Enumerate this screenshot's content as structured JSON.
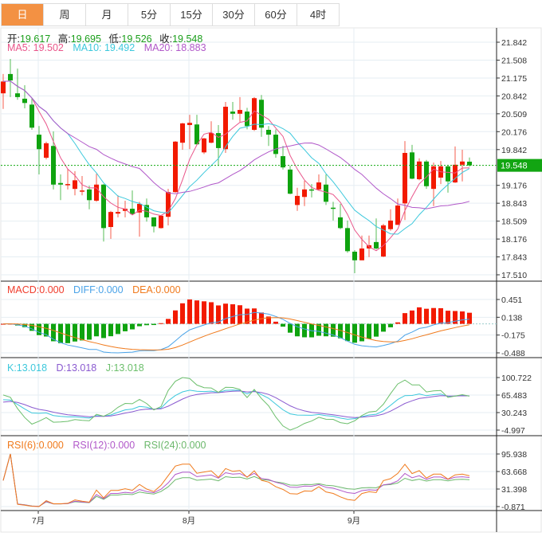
{
  "tabs": [
    {
      "label": "日",
      "active": true
    },
    {
      "label": "周"
    },
    {
      "label": "月"
    },
    {
      "label": "5分"
    },
    {
      "label": "15分"
    },
    {
      "label": "30分"
    },
    {
      "label": "60分"
    },
    {
      "label": "4时"
    }
  ],
  "ohlc_legend": {
    "open_label": "开:",
    "open": "19.617",
    "high_label": "高:",
    "high": "19.695",
    "low_label": "低:",
    "low": "19.526",
    "close_label": "收:",
    "close": "19.548"
  },
  "ma_legend": {
    "ma5": "MA5: 19.502",
    "ma10": "MA10: 19.492",
    "ma20": "MA20: 18.883"
  },
  "macd_legend": {
    "macd": "MACD:0.000",
    "diff": "DIFF:0.000",
    "dea": "DEA:0.000"
  },
  "kdj_legend": {
    "k": "K:13.018",
    "d": "D:13.018",
    "j": "J:13.018"
  },
  "rsi_legend": {
    "rsi6": "RSI(6):0.000",
    "rsi12": "RSI(12):0.000",
    "rsi24": "RSI(24):0.000"
  },
  "colors": {
    "up": "#f21a00",
    "down": "#0fa30f",
    "ma5": "#e9558a",
    "ma10": "#3cc8dc",
    "ma20": "#b158c9",
    "diff": "#4aa3e8",
    "dea": "#f07a1c",
    "k": "#3cc8dc",
    "d": "#8a5ad0",
    "j": "#6cbf6c",
    "rsi6": "#f07a1c",
    "rsi12": "#b158c9",
    "rsi24": "#6cb86c",
    "accent": "#f39143"
  },
  "chart_data": {
    "type": "candlestick",
    "current_price": "19.548",
    "price_axis": {
      "ticks": [
        "21.842",
        "21.508",
        "21.175",
        "20.842",
        "20.509",
        "20.176",
        "19.842",
        "19.176",
        "18.843",
        "18.509",
        "18.176",
        "17.843",
        "17.510"
      ],
      "ylim": [
        17.51,
        21.842
      ]
    },
    "macd_axis": {
      "ticks": [
        "0.451",
        "0.138",
        "-0.175",
        "-0.488"
      ],
      "ylim": [
        -0.488,
        0.451
      ]
    },
    "kdj_axis": {
      "ticks": [
        "100.722",
        "65.483",
        "30.243",
        "-4.997"
      ],
      "ylim": [
        -4.997,
        100.722
      ]
    },
    "rsi_axis": {
      "ticks": [
        "95.938",
        "63.668",
        "31.398",
        "-0.871"
      ],
      "ylim": [
        -0.871,
        95.938
      ]
    },
    "month_labels": [
      {
        "label": "7月",
        "index": 5
      },
      {
        "label": "8月",
        "index": 26
      },
      {
        "label": "9月",
        "index": 49
      }
    ],
    "candles": [
      [
        20.89,
        21.25,
        20.6,
        21.11
      ],
      [
        21.25,
        21.53,
        20.82,
        21.13
      ],
      [
        20.89,
        21.35,
        20.77,
        20.82
      ],
      [
        20.79,
        21.04,
        20.61,
        20.71
      ],
      [
        20.68,
        20.8,
        20.21,
        20.25
      ],
      [
        20.12,
        20.28,
        19.38,
        19.85
      ],
      [
        19.69,
        19.99,
        19.66,
        19.96
      ],
      [
        19.91,
        20.18,
        19.1,
        19.19
      ],
      [
        19.22,
        19.38,
        18.9,
        19.19
      ],
      [
        19.19,
        19.48,
        19.1,
        19.2
      ],
      [
        19.11,
        19.44,
        18.99,
        19.27
      ],
      [
        19.07,
        19.35,
        18.99,
        19.08
      ],
      [
        19.1,
        19.17,
        18.73,
        18.9
      ],
      [
        18.89,
        19.39,
        18.87,
        19.19
      ],
      [
        19.19,
        19.2,
        18.13,
        18.38
      ],
      [
        18.4,
        18.7,
        18.18,
        18.68
      ],
      [
        18.65,
        18.99,
        18.58,
        18.68
      ],
      [
        18.7,
        18.89,
        18.58,
        18.74
      ],
      [
        18.74,
        19.08,
        18.62,
        18.64
      ],
      [
        18.67,
        18.87,
        18.22,
        18.83
      ],
      [
        18.81,
        18.93,
        18.5,
        18.58
      ],
      [
        18.58,
        18.58,
        18.3,
        18.41
      ],
      [
        18.38,
        18.62,
        18.37,
        18.61
      ],
      [
        18.59,
        19.11,
        18.43,
        19.05
      ],
      [
        19.05,
        20.0,
        19.04,
        19.99
      ],
      [
        19.97,
        20.34,
        19.84,
        20.33
      ],
      [
        20.3,
        20.49,
        19.85,
        20.34
      ],
      [
        20.31,
        20.49,
        19.93,
        19.94
      ],
      [
        19.79,
        20.06,
        19.76,
        20.05
      ],
      [
        19.97,
        20.37,
        19.96,
        20.15
      ],
      [
        20.15,
        20.3,
        19.54,
        19.87
      ],
      [
        19.85,
        20.73,
        19.78,
        20.64
      ],
      [
        20.55,
        20.73,
        20.4,
        20.51
      ],
      [
        20.51,
        20.82,
        20.36,
        20.58
      ],
      [
        20.55,
        20.62,
        20.22,
        20.28
      ],
      [
        20.21,
        20.82,
        20.19,
        20.8
      ],
      [
        20.77,
        20.86,
        20.08,
        20.25
      ],
      [
        20.21,
        20.28,
        19.91,
        20.12
      ],
      [
        20.12,
        20.22,
        19.69,
        19.76
      ],
      [
        19.72,
        19.91,
        19.47,
        19.51
      ],
      [
        19.47,
        19.54,
        19.01,
        19.02
      ],
      [
        18.81,
        19.13,
        18.7,
        18.98
      ],
      [
        18.96,
        19.26,
        18.79,
        19.1
      ],
      [
        19.1,
        19.2,
        18.95,
        19.08
      ],
      [
        19.1,
        19.38,
        19.08,
        19.23
      ],
      [
        19.19,
        19.38,
        18.81,
        18.87
      ],
      [
        18.76,
        18.87,
        18.52,
        18.74
      ],
      [
        18.58,
        18.83,
        18.36,
        18.38
      ],
      [
        18.38,
        18.52,
        17.92,
        17.95
      ],
      [
        17.94,
        17.97,
        17.54,
        17.78
      ],
      [
        17.78,
        18.24,
        17.78,
        18.0
      ],
      [
        18.0,
        18.24,
        17.84,
        18.06
      ],
      [
        18.12,
        18.56,
        17.98,
        18.0
      ],
      [
        17.85,
        18.46,
        17.84,
        18.43
      ],
      [
        18.36,
        18.73,
        18.33,
        18.52
      ],
      [
        18.44,
        18.93,
        18.44,
        18.8
      ],
      [
        18.84,
        20.0,
        18.53,
        19.78
      ],
      [
        19.79,
        19.93,
        19.29,
        19.3
      ],
      [
        19.29,
        19.68,
        19.27,
        19.62
      ],
      [
        19.62,
        19.65,
        19.11,
        19.16
      ],
      [
        19.11,
        19.6,
        18.79,
        19.53
      ],
      [
        19.32,
        19.63,
        19.2,
        19.53
      ],
      [
        19.53,
        19.56,
        19.04,
        19.25
      ],
      [
        19.23,
        19.9,
        19.22,
        19.56
      ],
      [
        19.56,
        19.84,
        19.25,
        19.62
      ],
      [
        19.617,
        19.695,
        19.526,
        19.548
      ]
    ]
  }
}
